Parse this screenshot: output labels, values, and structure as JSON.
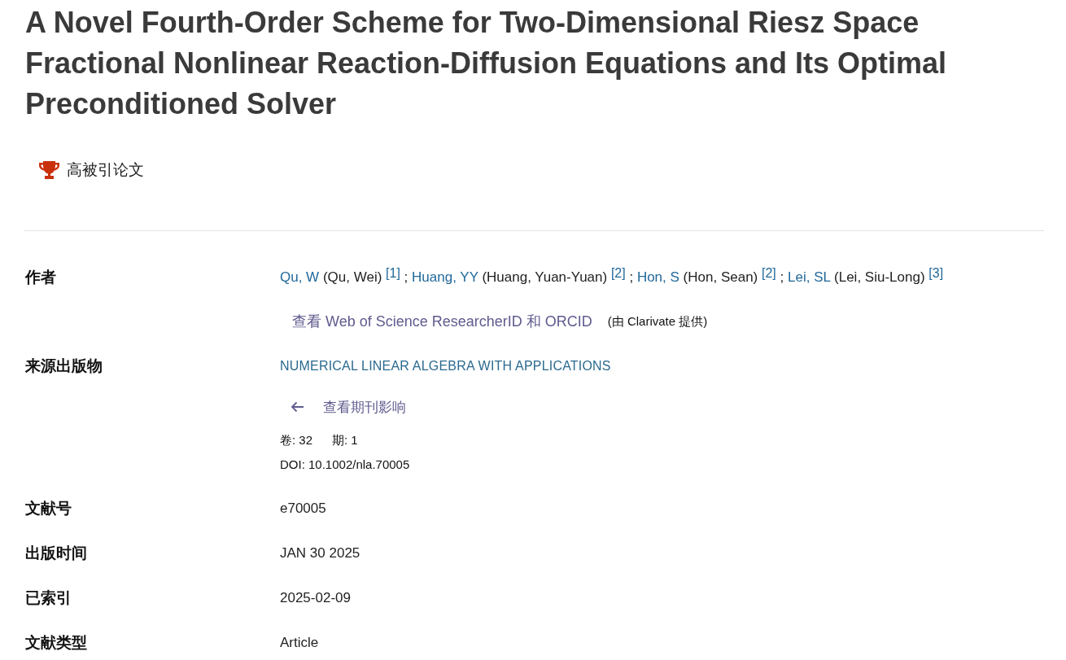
{
  "title": "A Novel Fourth-Order Scheme for Two-Dimensional Riesz Space Fractional Nonlinear Reaction-Diffusion Equations and Its Optimal Preconditioned Solver",
  "badge": {
    "label": "高被引论文"
  },
  "fields": [
    {
      "kind": "authors",
      "label": "作者",
      "authors": [
        {
          "short": "Qu, W",
          "full": "(Qu, Wei)",
          "ref": "[1]",
          "sep": ";"
        },
        {
          "short": "Huang, YY",
          "full": "(Huang, Yuan-Yuan)",
          "ref": "[2]",
          "sep": ";"
        },
        {
          "short": "Hon, S",
          "full": "(Hon, Sean)",
          "ref": "[2]",
          "sep": ";"
        },
        {
          "short": "Lei, SL",
          "full": "(Lei, Siu-Long)",
          "ref": "[3]"
        }
      ],
      "link": "查看 Web of Science ResearcherID 和 ORCID",
      "note": "(由 Clarivate 提供)"
    },
    {
      "kind": "source",
      "label": "来源出版物",
      "value": "NUMERICAL LINEAR ALGEBRA WITH APPLICATIONS",
      "link": "查看期刊影响",
      "volume": "卷: 32",
      "issue": "期: 1",
      "doi": "DOI: 10.1002/nla.70005"
    },
    {
      "kind": "text",
      "label": "文献号",
      "value": "e70005"
    },
    {
      "kind": "text",
      "label": "出版时间",
      "value": "JAN 30 2025"
    },
    {
      "kind": "text",
      "label": "已索引",
      "value": "2025-02-09"
    },
    {
      "kind": "text",
      "label": "文献类型",
      "value": "Article"
    }
  ]
}
